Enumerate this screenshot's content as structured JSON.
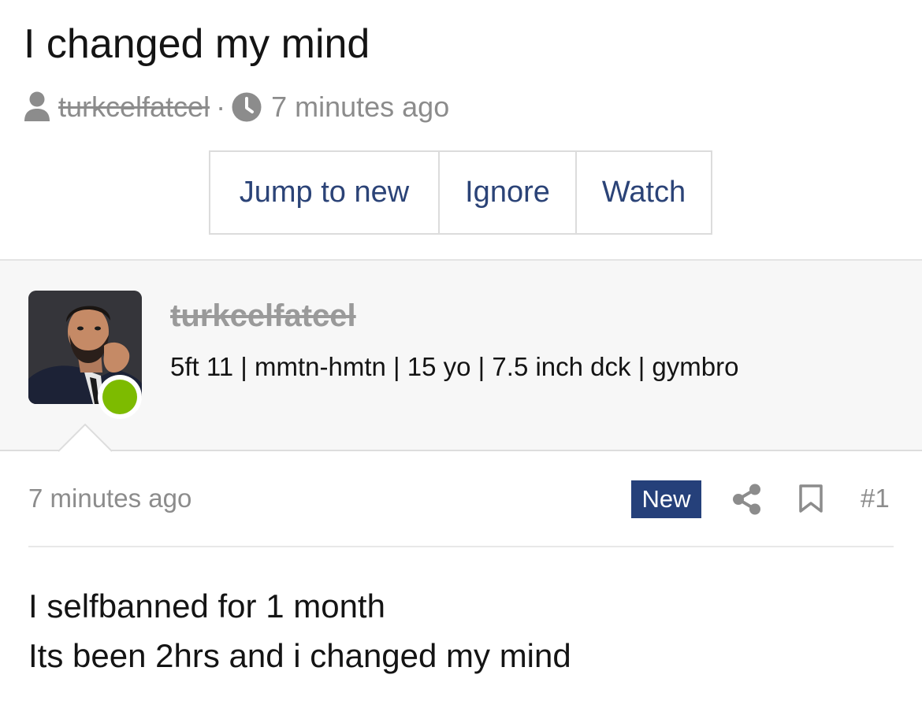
{
  "thread": {
    "title": "I changed my mind",
    "author": "turkcelfatcel",
    "separator": "·",
    "time_ago": "7 minutes ago"
  },
  "actions": {
    "jump_to_new": "Jump to new",
    "ignore": "Ignore",
    "watch": "Watch"
  },
  "post": {
    "username": "turkcelfatcel",
    "user_title": "5ft 11 | mmtn-hmtn | 15 yo | 7.5 inch dck | gymbro",
    "online": true,
    "date": "7 minutes ago",
    "new_badge": "New",
    "number": "#1",
    "body_lines": [
      "I selfbanned for 1 month",
      "Its been 2hrs and i changed my mind"
    ]
  },
  "colors": {
    "link": "#2b4377",
    "badge": "#25407a",
    "online": "#7dbb00",
    "muted": "#8c8c8c"
  },
  "icons": {
    "author": "user-icon",
    "time": "clock-icon",
    "share": "share-icon",
    "bookmark": "bookmark-icon"
  }
}
